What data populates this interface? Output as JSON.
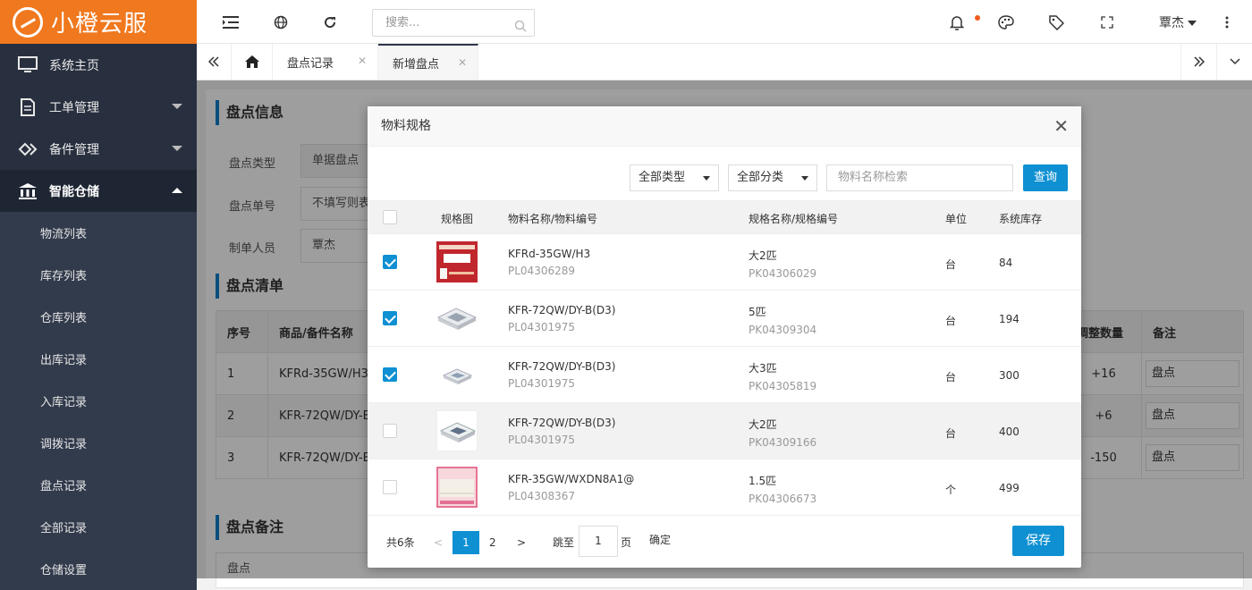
{
  "app": {
    "title": "小橙云服"
  },
  "sidebar": {
    "items": [
      {
        "label": "系统主页"
      },
      {
        "label": "工单管理"
      },
      {
        "label": "备件管理"
      },
      {
        "label": "智能仓储"
      }
    ],
    "sub_items": [
      {
        "label": "物流列表"
      },
      {
        "label": "库存列表"
      },
      {
        "label": "仓库列表"
      },
      {
        "label": "出库记录"
      },
      {
        "label": "入库记录"
      },
      {
        "label": "调拨记录"
      },
      {
        "label": "盘点记录"
      },
      {
        "label": "全部记录"
      },
      {
        "label": "仓储设置"
      }
    ]
  },
  "header": {
    "search_placeholder": "搜索...",
    "user": "覃杰"
  },
  "tabs": [
    {
      "label": "盘点记录"
    },
    {
      "label": "新增盘点"
    }
  ],
  "form": {
    "section_info": "盘点信息",
    "type_label": "盘点类型",
    "type_value": "单据盘点",
    "number_label": "盘点单号",
    "number_value": "不填写则表",
    "maker_label": "制单人员",
    "maker_value": "覃杰",
    "section_list": "盘点清单",
    "section_remark": "盘点备注",
    "remark_value": "盘点"
  },
  "bg_table": {
    "headers": {
      "no": "序号",
      "name": "商品/备件名称",
      "adjust": "调整数量",
      "remark": "备注"
    },
    "rows": [
      {
        "no": "1",
        "name": "KFRd-35GW/H3(",
        "adjust": "+16",
        "remark": "盘点"
      },
      {
        "no": "2",
        "name": "KFR-72QW/DY-E",
        "adjust": "+6",
        "remark": "盘点"
      },
      {
        "no": "3",
        "name": "KFR-72QW/DY-E",
        "adjust": "-150",
        "remark": "盘点"
      }
    ]
  },
  "modal": {
    "title": "物料规格",
    "filter_type": "全部类型",
    "filter_category": "全部分类",
    "search_placeholder": "物料名称检索",
    "query_label": "查询",
    "headers": {
      "image": "规格图",
      "name": "物料名称/物料编号",
      "spec": "规格名称/规格编号",
      "unit": "单位",
      "stock": "系统库存"
    },
    "rows": [
      {
        "checked": true,
        "name": "KFRd-35GW/H3",
        "code": "PL04306289",
        "spec": "大2匹",
        "spec_code": "PK04306029",
        "unit": "台",
        "stock": "84",
        "thumb": "ac-box-red"
      },
      {
        "checked": true,
        "name": "KFR-72QW/DY-B(D3)",
        "code": "PL04301975",
        "spec": "5匹",
        "spec_code": "PK04309304",
        "unit": "台",
        "stock": "194",
        "thumb": "ceiling-cassette"
      },
      {
        "checked": true,
        "name": "KFR-72QW/DY-B(D3)",
        "code": "PL04301975",
        "spec": "大3匹",
        "spec_code": "PK04305819",
        "unit": "台",
        "stock": "300",
        "thumb": "ceiling-cassette"
      },
      {
        "checked": false,
        "name": "KFR-72QW/DY-B(D3)",
        "code": "PL04301975",
        "spec": "大2匹",
        "spec_code": "PK04309166",
        "unit": "台",
        "stock": "400",
        "thumb": "ceiling-cassette"
      },
      {
        "checked": false,
        "name": "KFR-35GW/WXDN8A1@",
        "code": "PL04308367",
        "spec": "1.5匹",
        "spec_code": "PK04306673",
        "unit": "个",
        "stock": "499",
        "thumb": "wall-unit-pink"
      }
    ],
    "pagination": {
      "total": "共6条",
      "prev": "<",
      "pages": [
        "1",
        "2"
      ],
      "next": ">",
      "jump_label": "跳至",
      "jump_value": "1",
      "page_unit": "页",
      "confirm": "确定"
    },
    "save_label": "保存"
  },
  "colors": {
    "brand": "#f0781e",
    "sidebar": "#28303f",
    "primary": "#0e90d2"
  }
}
